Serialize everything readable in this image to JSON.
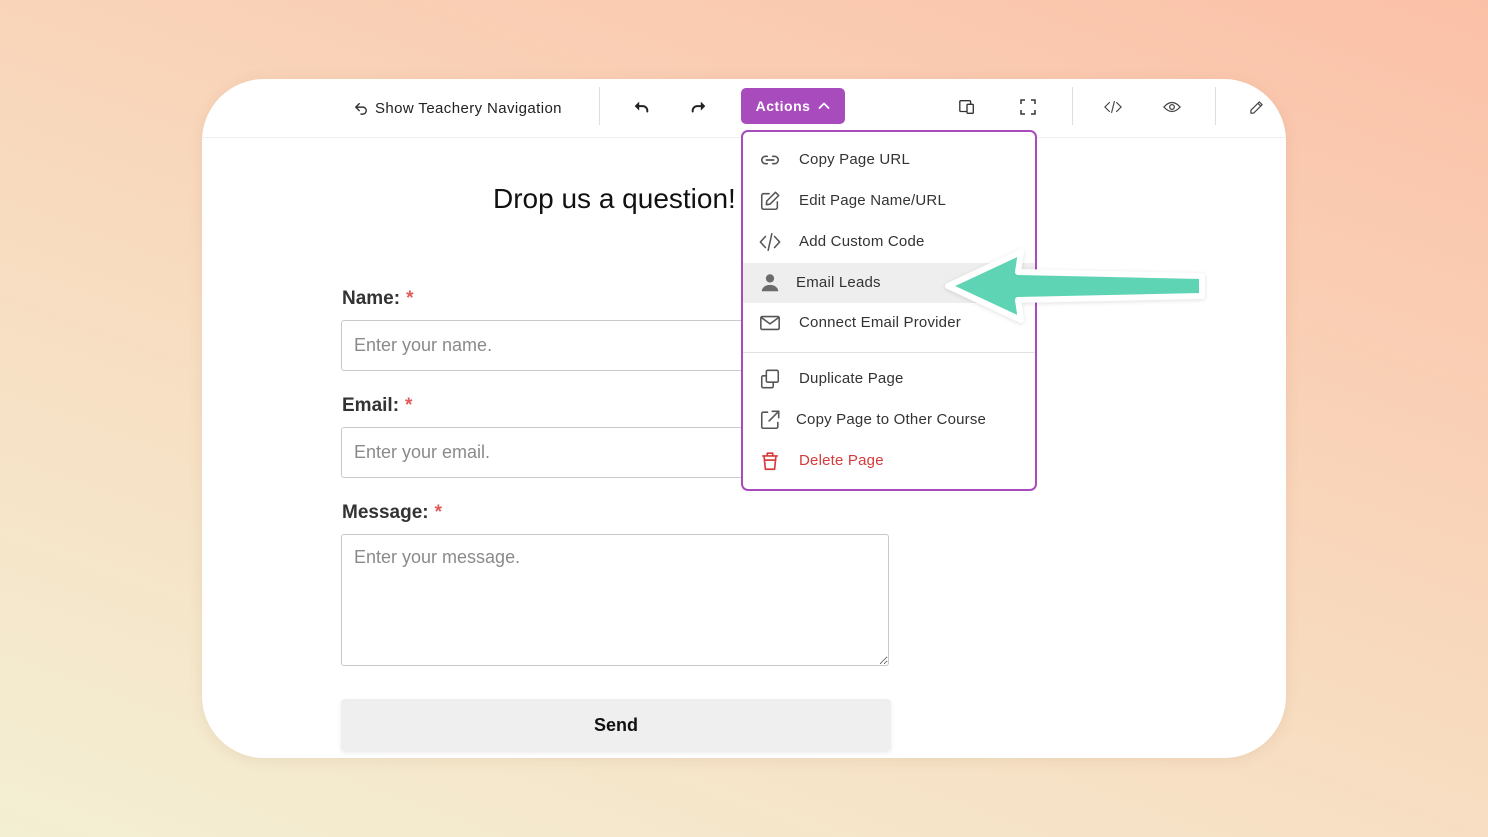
{
  "toolbar": {
    "nav_label": "Show Teachery Navigation",
    "actions_label": "Actions"
  },
  "form": {
    "title": "Drop us a question!",
    "name_label": "Name:",
    "name_placeholder": "Enter your name.",
    "email_label": "Email:",
    "email_placeholder": "Enter your email.",
    "message_label": "Message:",
    "message_placeholder": "Enter your message.",
    "required_mark": "*",
    "send_label": "Send"
  },
  "menu": {
    "items": [
      {
        "label": "Copy Page URL",
        "icon": "link-icon"
      },
      {
        "label": "Edit Page Name/URL",
        "icon": "edit-icon"
      },
      {
        "label": "Add Custom Code",
        "icon": "code-icon"
      },
      {
        "label": "Email Leads",
        "icon": "user-icon",
        "highlighted": true
      },
      {
        "label": "Connect Email Provider",
        "icon": "envelope-icon"
      },
      {
        "label": "Duplicate Page",
        "icon": "duplicate-icon"
      },
      {
        "label": "Copy Page to Other Course",
        "icon": "external-link-icon"
      },
      {
        "label": "Delete Page",
        "icon": "trash-icon",
        "danger": true
      }
    ]
  },
  "colors": {
    "accent": "#a84bbd",
    "danger": "#d63a3a",
    "required": "#e05a5a",
    "callout_arrow": "#5fd4b5"
  }
}
